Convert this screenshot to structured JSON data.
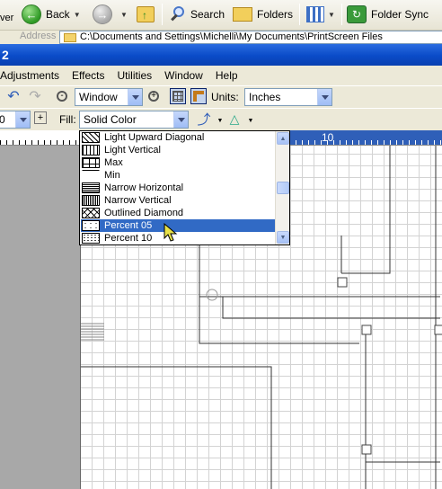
{
  "explorer": {
    "back_label": "Back",
    "search_label": "Search",
    "folders_label": "Folders",
    "folder_sync_label": "Folder Sync",
    "address_label": "Address",
    "address_value": "C:\\Documents and Settings\\Michelli\\My Documents\\PrintScreen Files",
    "left_clip": "ver"
  },
  "app": {
    "title_fragment": "2"
  },
  "menu": {
    "items": [
      "Adjustments",
      "Effects",
      "Utilities",
      "Window",
      "Help"
    ]
  },
  "toolbar": {
    "zoom_value": "Window",
    "units_label": "Units:",
    "units_value": "Inches",
    "left_combo_value": "0",
    "fill_label": "Fill:",
    "fill_value": "Solid Color"
  },
  "ruler": {
    "number": "10"
  },
  "fill_list": {
    "options": [
      {
        "label": "Light Upward Diagonal",
        "pattern": "light-upward-diagonal"
      },
      {
        "label": "Light Vertical",
        "pattern": "light-vertical"
      },
      {
        "label": "Max",
        "pattern": "max"
      },
      {
        "label": "Min",
        "pattern": "min"
      },
      {
        "label": "Narrow Horizontal",
        "pattern": "narrow-horizontal"
      },
      {
        "label": "Narrow Vertical",
        "pattern": "narrow-vertical"
      },
      {
        "label": "Outlined Diamond",
        "pattern": "outlined-diamond"
      },
      {
        "label": "Percent 05",
        "pattern": "percent-05"
      },
      {
        "label": "Percent 10",
        "pattern": "percent-10"
      }
    ],
    "selected": "Percent 05"
  },
  "colors": {
    "titlebar": "#0a4bc8",
    "selection": "#316ac5",
    "ruler_blue": "#2f5fb8",
    "canvas_grid": "#d3d3d3"
  }
}
